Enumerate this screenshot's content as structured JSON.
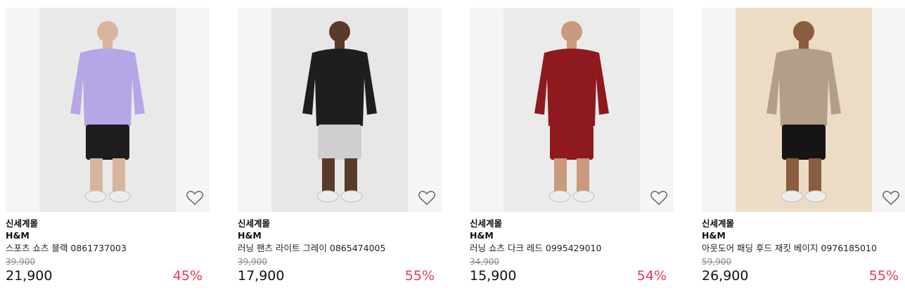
{
  "products": [
    {
      "mall": "신세계몰",
      "brand": "H&M",
      "name": "스포츠 쇼츠 블랙 0861737003",
      "original_price": "39,900",
      "price": "21,900",
      "discount": "45%",
      "photo_bg": "#e9e9e9",
      "top_color": "#b7a6e6",
      "bottom_color": "#1d1d1d",
      "skin": "#d9b49c",
      "wishlist_icon": "heart-outline-icon"
    },
    {
      "mall": "신세계몰",
      "brand": "H&M",
      "name": "러닝 팬츠 라이트 그레이 0865474005",
      "original_price": "39,900",
      "price": "17,900",
      "discount": "55%",
      "photo_bg": "#e7e7e7",
      "top_color": "#1e1e1e",
      "bottom_color": "#cfcfd2",
      "skin": "#5a3a28",
      "wishlist_icon": "heart-outline-icon"
    },
    {
      "mall": "신세계몰",
      "brand": "H&M",
      "name": "러닝 쇼츠 다크 레드 0995429010",
      "original_price": "34,900",
      "price": "15,900",
      "discount": "54%",
      "photo_bg": "#ebebeb",
      "top_color": "#8e1a1f",
      "bottom_color": "#8e1a1f",
      "skin": "#c99a7e",
      "wishlist_icon": "heart-outline-icon"
    },
    {
      "mall": "신세계몰",
      "brand": "H&M",
      "name": "아웃도어 패딩 후드 재킷 베이지 0976185010",
      "original_price": "59,900",
      "price": "26,900",
      "discount": "55%",
      "photo_bg": "#ecdcc6",
      "top_color": "#b39f88",
      "bottom_color": "#151515",
      "skin": "#8a5c40",
      "wishlist_icon": "heart-outline-icon"
    }
  ],
  "colors": {
    "discount": "#e8384a",
    "strike": "#8a8a8a",
    "tile": "#f5f5f5"
  }
}
